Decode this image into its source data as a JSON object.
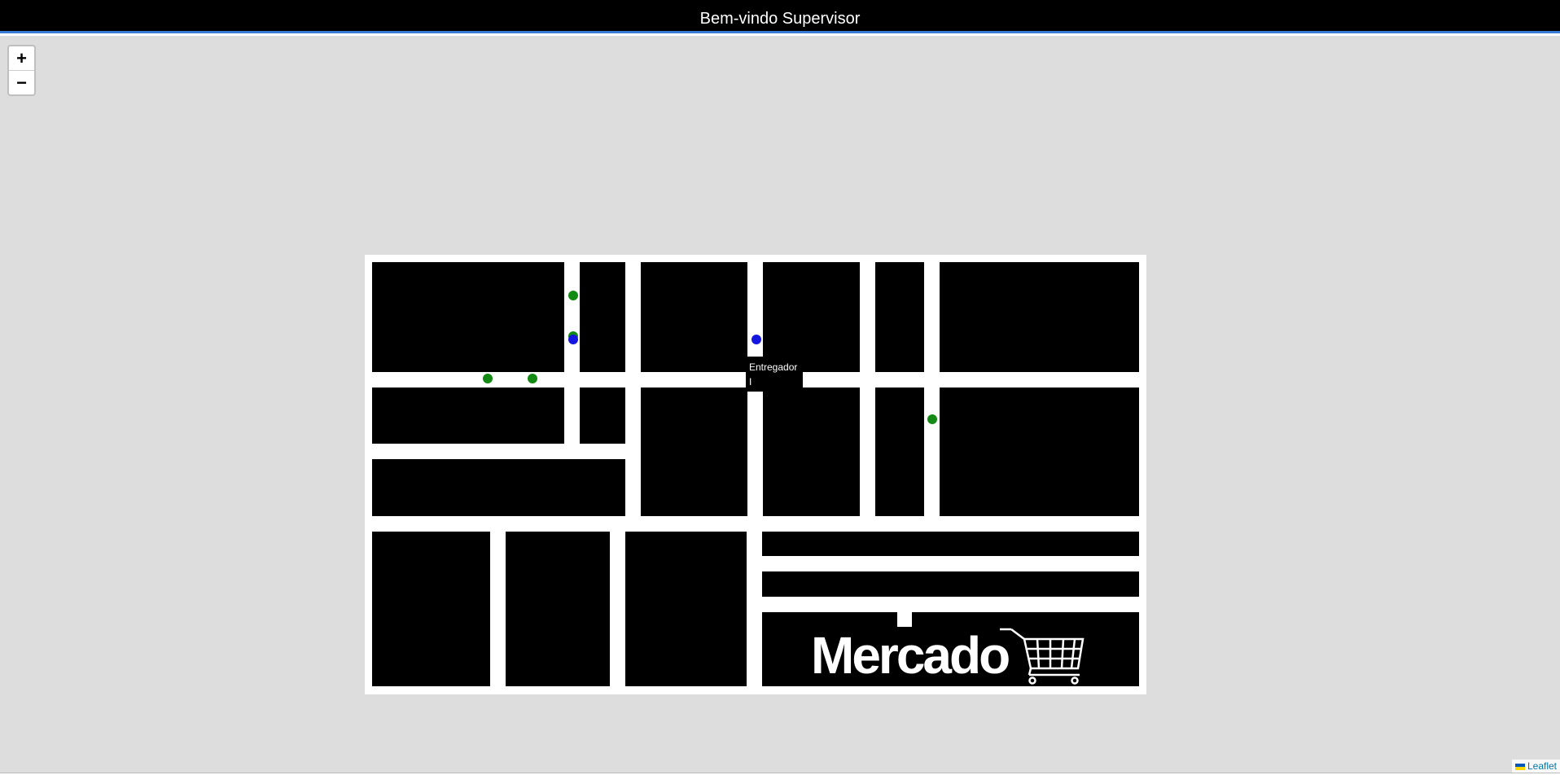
{
  "header": {
    "title": "Bem-vindo Supervisor"
  },
  "map": {
    "zoom_in": "+",
    "zoom_out": "−",
    "tooltip": {
      "line1": "Entregador",
      "line2": "I"
    },
    "logo_text": "Mercado",
    "attribution": "Leaflet",
    "markers": [
      {
        "type": "green"
      },
      {
        "type": "green"
      },
      {
        "type": "green"
      },
      {
        "type": "green"
      },
      {
        "type": "green"
      },
      {
        "type": "blue"
      },
      {
        "type": "blue"
      }
    ]
  },
  "colors": {
    "green_marker": "#138a13",
    "blue_marker": "#1515e0",
    "header_accent": "#3a7bd5"
  }
}
